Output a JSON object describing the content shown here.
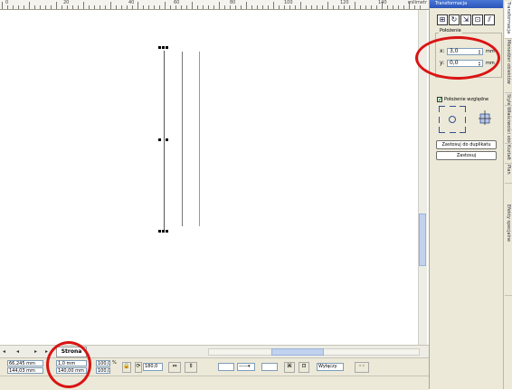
{
  "ruler": {
    "labels": [
      "0",
      "20",
      "40",
      "60",
      "80",
      "100",
      "120",
      "140"
    ],
    "unit": "milimetr"
  },
  "page_tabs": {
    "nav": [
      "◂",
      "◂",
      "▸",
      "▸"
    ],
    "active_tab": "Strona"
  },
  "property_bar": {
    "x_pos": "66,245 mm",
    "y_pos": "144,03 mm",
    "width": "1,0 mm",
    "height": "140,00 mm",
    "scale_w": "100,0",
    "scale_h": "100,0",
    "scale_unit": "%",
    "rotation": "180,0",
    "font_size": "Wyłączy",
    "status_text": ""
  },
  "docker": {
    "title": "Transformacja",
    "group_title": "Położenie",
    "x_label": "x:",
    "y_label": "y:",
    "x_value": "3,0",
    "y_value": "0,0",
    "unit": "mm",
    "relative_label": "Położenie względne",
    "relative_checked": "✔",
    "apply_duplicate": "Zastosuj do duplikatu",
    "apply": "Zastosuj",
    "icons": [
      "position-icon",
      "rotate-icon",
      "scale-icon",
      "size-icon",
      "skew-icon"
    ]
  },
  "side_tabs": [
    "Transformacja",
    "Menedżer obiektów",
    "Właściwości obiektu",
    "Style",
    "Kształt",
    "Plan",
    "Efekty specjalne"
  ],
  "colors": {
    "annotation": "#d91414",
    "accent": "#2a55b8"
  }
}
